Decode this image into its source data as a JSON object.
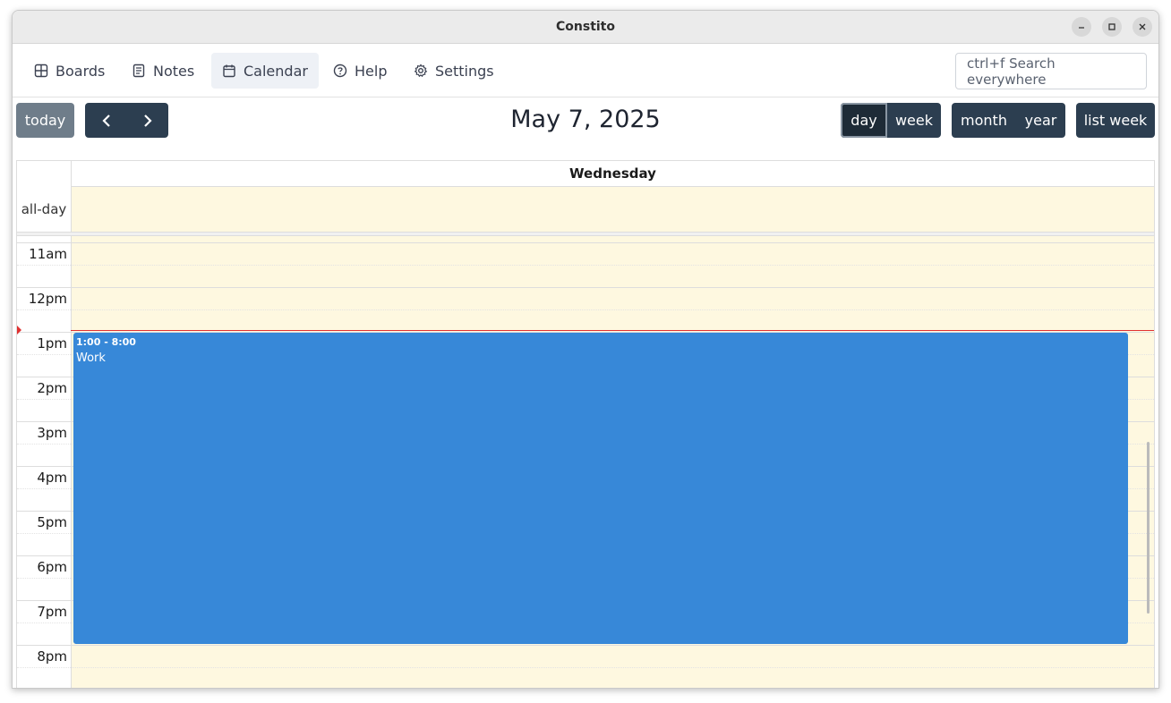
{
  "window": {
    "title": "Constito"
  },
  "nav": {
    "items": [
      {
        "label": "Boards",
        "icon": "grid-icon"
      },
      {
        "label": "Notes",
        "icon": "note-icon"
      },
      {
        "label": "Calendar",
        "icon": "calendar-icon",
        "active": true
      },
      {
        "label": "Help",
        "icon": "help-circle-icon"
      },
      {
        "label": "Settings",
        "icon": "gear-icon"
      }
    ],
    "search_placeholder": "ctrl+f Search everywhere"
  },
  "toolbar": {
    "today_label": "today",
    "prev_icon": "chevron-left-icon",
    "next_icon": "chevron-right-icon",
    "title": "May 7, 2025",
    "view_day": "day",
    "view_week": "week",
    "view_month": "month",
    "view_year": "year",
    "view_list_week": "list week",
    "active_view": "day"
  },
  "calendar": {
    "day_header": "Wednesday",
    "allday_label": "all-day",
    "hours": [
      "11am",
      "12pm",
      "1pm",
      "2pm",
      "3pm",
      "4pm",
      "5pm",
      "6pm",
      "7pm",
      "8pm"
    ],
    "event": {
      "time": "1:00 - 8:00",
      "title": "Work",
      "color": "#3788d8"
    },
    "highlight_color": "#fef8e0",
    "now_indicator_color": "#e03131"
  }
}
